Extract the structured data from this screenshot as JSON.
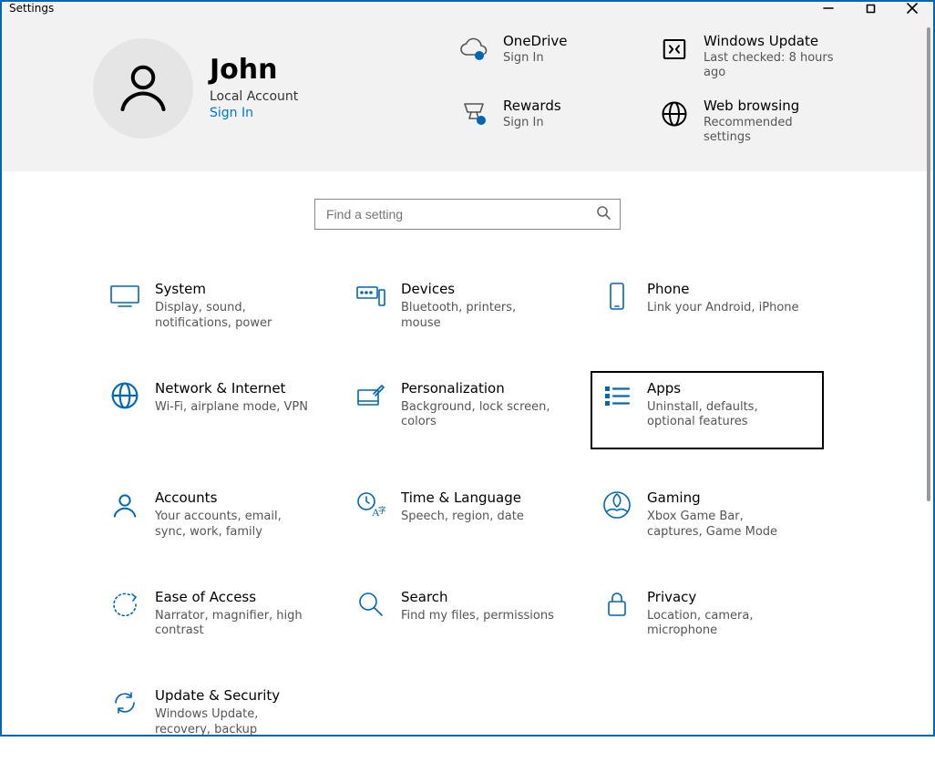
{
  "window": {
    "title": "Settings"
  },
  "user": {
    "name": "John",
    "account_type": "Local Account",
    "signin": "Sign In"
  },
  "quick": {
    "onedrive": {
      "title": "OneDrive",
      "sub": "Sign In"
    },
    "update": {
      "title": "Windows Update",
      "sub": "Last checked: 8 hours ago"
    },
    "rewards": {
      "title": "Rewards",
      "sub": "Sign In"
    },
    "web": {
      "title": "Web browsing",
      "sub": "Recommended settings"
    }
  },
  "search": {
    "placeholder": "Find a setting"
  },
  "cats": {
    "system": {
      "title": "System",
      "sub": "Display, sound, notifications, power"
    },
    "devices": {
      "title": "Devices",
      "sub": "Bluetooth, printers, mouse"
    },
    "phone": {
      "title": "Phone",
      "sub": "Link your Android, iPhone"
    },
    "network": {
      "title": "Network & Internet",
      "sub": "Wi-Fi, airplane mode, VPN"
    },
    "personalization": {
      "title": "Personalization",
      "sub": "Background, lock screen, colors"
    },
    "apps": {
      "title": "Apps",
      "sub": "Uninstall, defaults, optional features"
    },
    "accounts": {
      "title": "Accounts",
      "sub": "Your accounts, email, sync, work, family"
    },
    "time": {
      "title": "Time & Language",
      "sub": "Speech, region, date"
    },
    "gaming": {
      "title": "Gaming",
      "sub": "Xbox Game Bar, captures, Game Mode"
    },
    "ease": {
      "title": "Ease of Access",
      "sub": "Narrator, magnifier, high contrast"
    },
    "search": {
      "title": "Search",
      "sub": "Find my files, permissions"
    },
    "privacy": {
      "title": "Privacy",
      "sub": "Location, camera, microphone"
    },
    "update": {
      "title": "Update & Security",
      "sub": "Windows Update, recovery, backup"
    }
  }
}
